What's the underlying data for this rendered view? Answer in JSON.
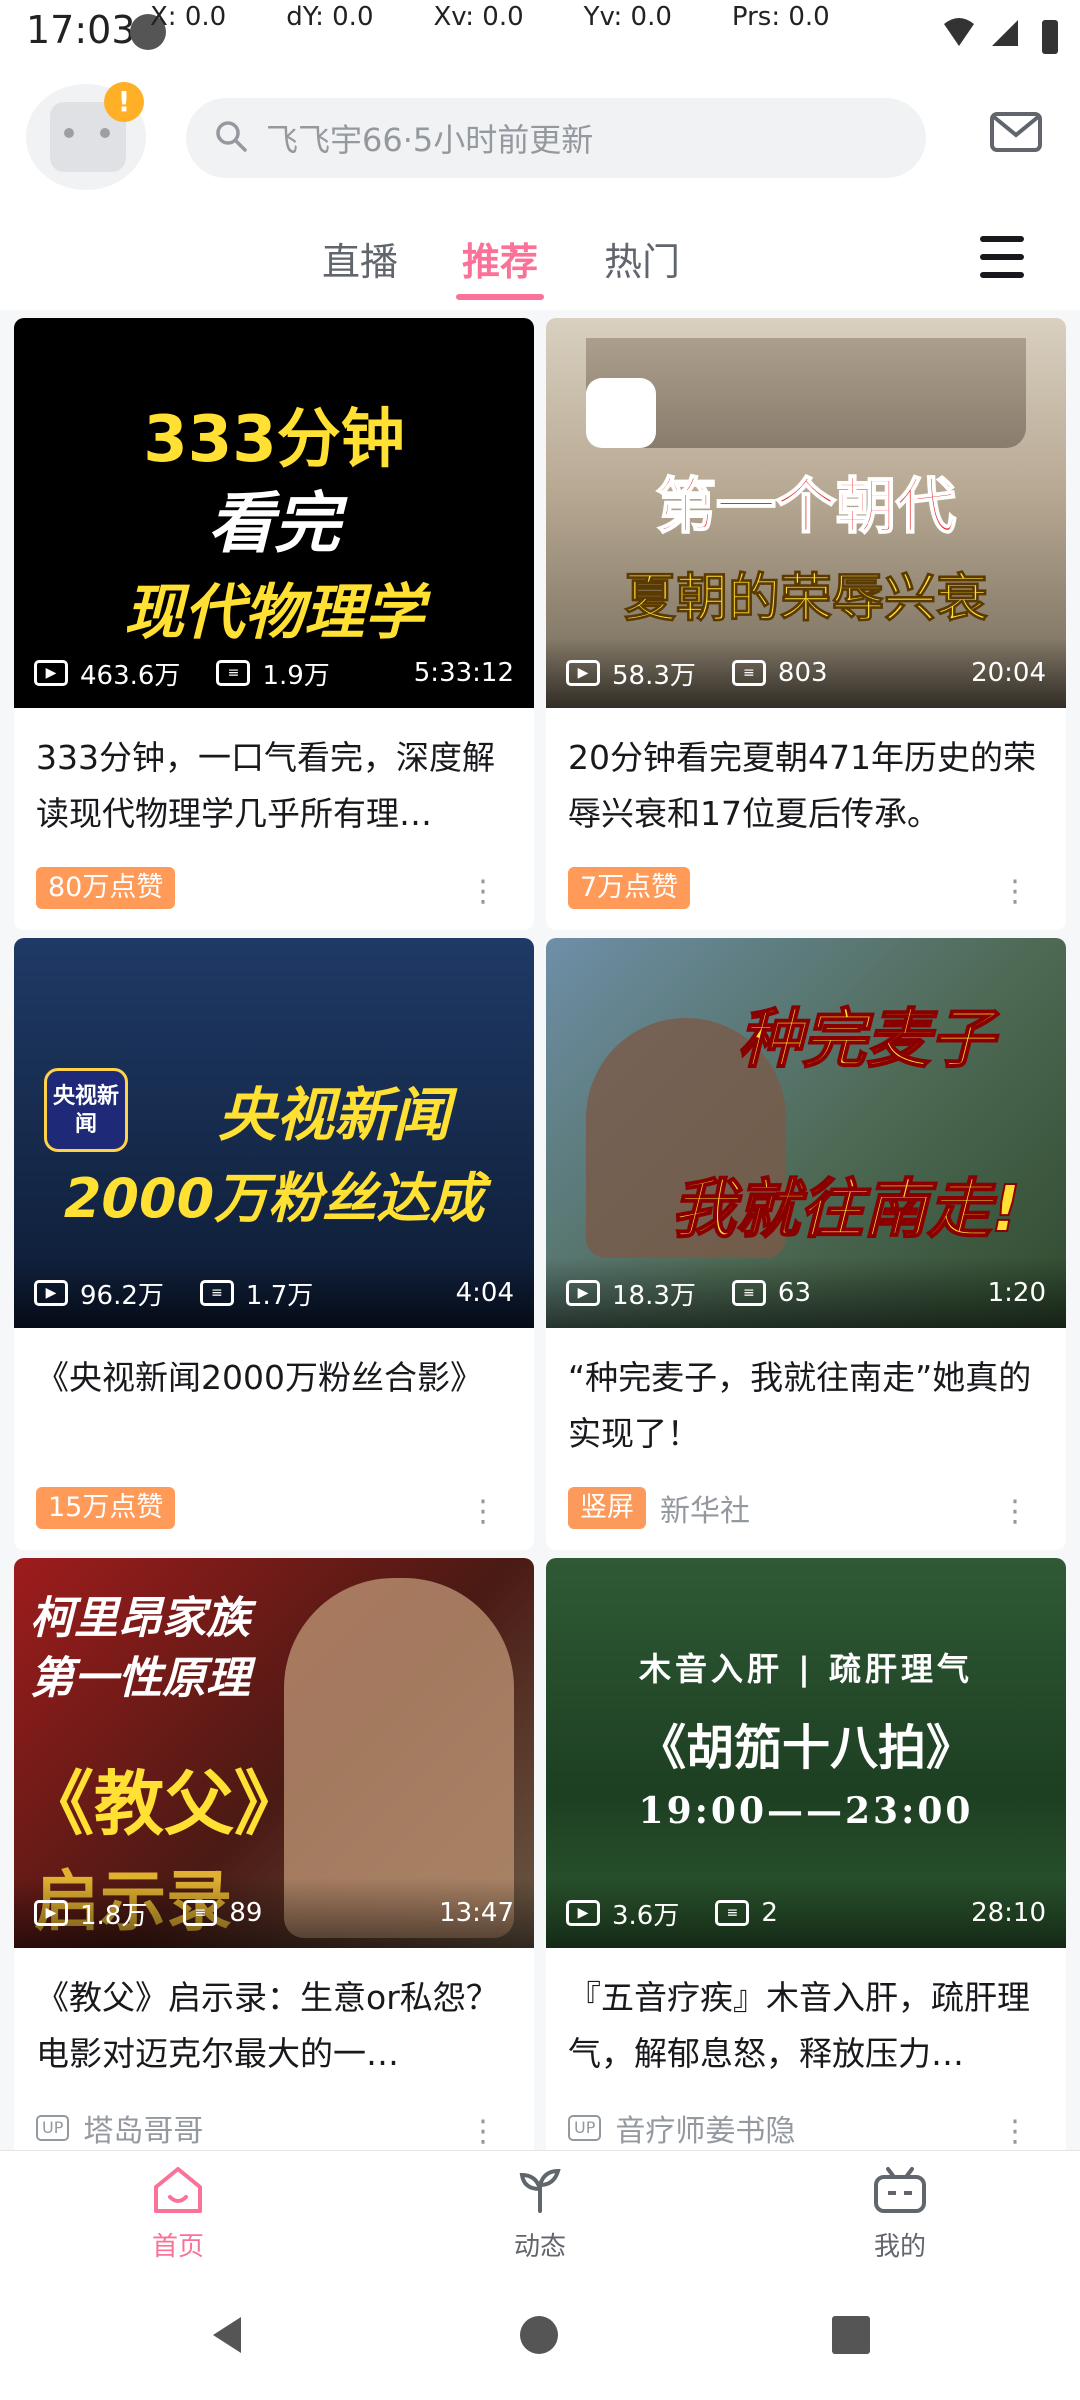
{
  "status_bar": {
    "time": "17:03",
    "debug": [
      "X: 0.0",
      "dY: 0.0",
      "Xv: 0.0",
      "Yv: 0.0",
      "Prs: 0.0"
    ]
  },
  "header": {
    "search_placeholder": "飞飞宇66·5小时前更新",
    "avatar_badge": "!"
  },
  "tabs": {
    "live": "直播",
    "recommend": "推荐",
    "hot": "热门"
  },
  "cards": [
    {
      "thumb_line1": "333分钟",
      "thumb_line2": "看完",
      "thumb_line3": "现代物理学",
      "views": "463.6万",
      "danmaku": "1.9万",
      "duration": "5:33:12",
      "title": "333分钟，一口气看完，深度解读现代物理学几乎所有理…",
      "tag": "80万点赞",
      "uploader": ""
    },
    {
      "thumb_line1": "第一个朝代",
      "thumb_line2": "夏朝的荣辱兴衰",
      "views": "58.3万",
      "danmaku": "803",
      "duration": "20:04",
      "title": "20分钟看完夏朝471年历史的荣辱兴衰和17位夏后传承。",
      "tag": "7万点赞",
      "uploader": ""
    },
    {
      "thumb_line1": "央视新闻",
      "thumb_line2": "2000万粉丝达成",
      "thumb_logo": "央视新闻",
      "views": "96.2万",
      "danmaku": "1.7万",
      "duration": "4:04",
      "title": "《央视新闻2000万粉丝合影》",
      "tag": "15万点赞",
      "uploader": ""
    },
    {
      "thumb_line1": "种完麦子",
      "thumb_line2": "我就往南走!",
      "views": "18.3万",
      "danmaku": "63",
      "duration": "1:20",
      "title": "“种完麦子，我就往南走”她真的实现了！",
      "tag": "竖屏",
      "uploader": "新华社"
    },
    {
      "thumb_line1": "柯里昂家族",
      "thumb_line2": "第一性原理",
      "thumb_line3": "《教父》",
      "thumb_line4": "启示录",
      "views": "1.8万",
      "danmaku": "89",
      "duration": "13:47",
      "title": "《教父》启示录：生意or私怨？电影对迈克尔最大的一…",
      "tag": "",
      "uploader": "塔岛哥哥"
    },
    {
      "thumb_line1": "木音入肝 | 疏肝理气",
      "thumb_line2": "《胡笳十八拍》",
      "thumb_line3": "19:00——23:00",
      "views": "3.6万",
      "danmaku": "2",
      "duration": "28:10",
      "title": "『五音疗疾』木音入肝，疏肝理气，解郁息怒，释放压力…",
      "tag": "",
      "uploader": "音疗师姜书隐"
    }
  ],
  "bottom_nav": {
    "home": "首页",
    "dynamic": "动态",
    "mine": "我的"
  },
  "colors": {
    "brand_pink": "#fb7299",
    "tag_orange": "#ff9a59"
  }
}
